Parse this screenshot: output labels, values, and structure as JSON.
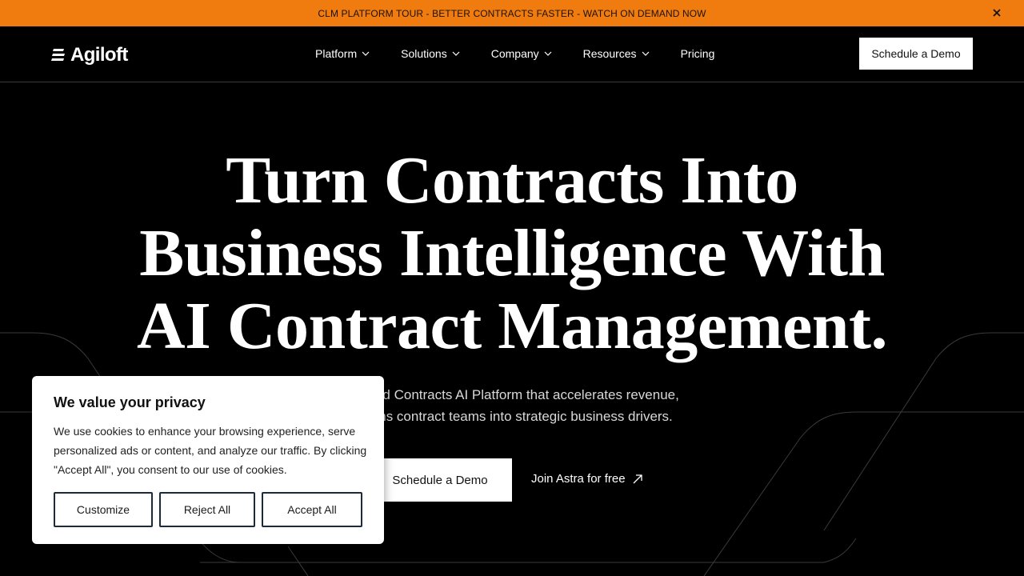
{
  "announcement": {
    "text": "CLM PLATFORM TOUR - BETTER CONTRACTS FASTER - WATCH ON DEMAND NOW",
    "close_icon": "close-icon"
  },
  "header": {
    "logo_text": "Agiloft",
    "nav": [
      {
        "label": "Platform",
        "has_dropdown": true
      },
      {
        "label": "Solutions",
        "has_dropdown": true
      },
      {
        "label": "Company",
        "has_dropdown": true
      },
      {
        "label": "Resources",
        "has_dropdown": true
      },
      {
        "label": "Pricing",
        "has_dropdown": false
      }
    ],
    "cta_label": "Schedule a Demo"
  },
  "hero": {
    "title_lines": [
      "Turn Contracts Into",
      "Business Intelligence With",
      "AI Contract Management."
    ],
    "subtitle_lines": [
      "LM and Contracts AI Platform that accelerates revenue,",
      "d turns contract teams into strategic business drivers."
    ],
    "primary_cta": "Schedule a Demo",
    "secondary_cta": "Join Astra for free"
  },
  "cookie": {
    "title": "We value your privacy",
    "body": "We use cookies to enhance your browsing experience, serve personalized ads or content, and analyze our traffic. By clicking \"Accept All\", you consent to our use of cookies.",
    "buttons": {
      "customize": "Customize",
      "reject": "Reject All",
      "accept": "Accept All"
    }
  },
  "colors": {
    "accent": "#f07b0f",
    "background": "#000000",
    "text": "#ffffff"
  }
}
